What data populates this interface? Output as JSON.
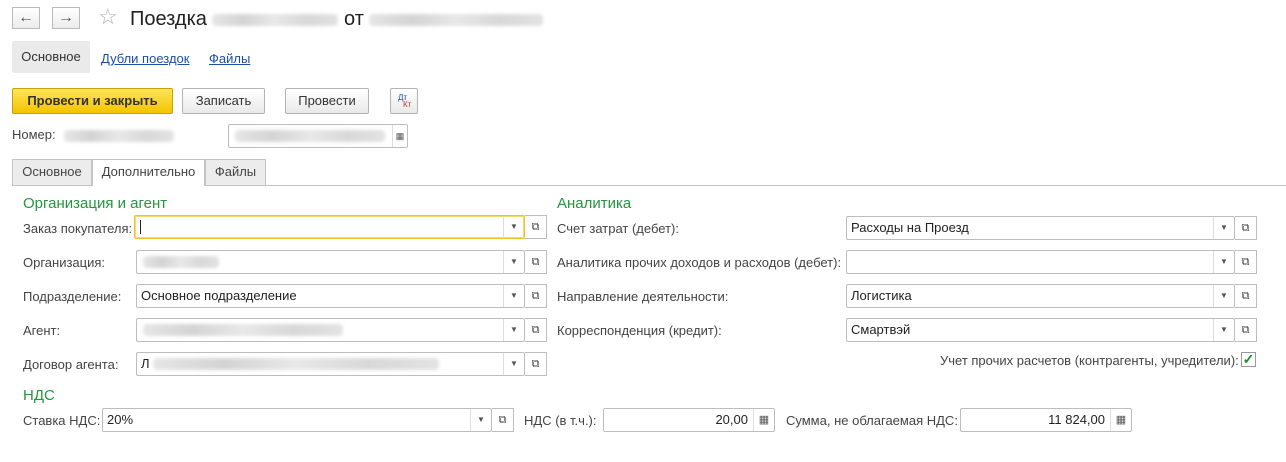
{
  "header": {
    "back_icon": "←",
    "forward_icon": "→",
    "star_icon": "☆",
    "title_prefix": "Поездка",
    "title_middle": "от"
  },
  "sections": {
    "main": "Основное",
    "duplicates": "Дубли поездок",
    "files": "Файлы"
  },
  "toolbar": {
    "post_close": "Провести и закрыть",
    "save": "Записать",
    "post": "Провести",
    "dtkt_top": "Дт",
    "dtkt_bottom": "Кт"
  },
  "number": {
    "label": "Номер:"
  },
  "tabs": [
    "Основное",
    "Дополнительно",
    "Файлы"
  ],
  "org_group": {
    "title": "Организация и агент",
    "order_label": "Заказ покупателя:",
    "order_value": "",
    "org_label": "Организация:",
    "dept_label": "Подразделение:",
    "dept_value": "Основное подразделение",
    "agent_label": "Агент:",
    "contract_label": "Договор агента:",
    "contract_prefix": "Л"
  },
  "analytics": {
    "title": "Аналитика",
    "cost_label": "Счет затрат (дебет):",
    "cost_value": "Расходы на Проезд",
    "other_label": "Аналитика прочих доходов и расходов (дебет):",
    "other_value": "",
    "direction_label": "Направление деятельности:",
    "direction_value": "Логистика",
    "corr_label": "Корреспонденция (кредит):",
    "corr_value": "Смартвэй",
    "accounting_label": "Учет прочих расчетов (контрагенты, учредители):",
    "accounting_checked": "✓"
  },
  "vat": {
    "title": "НДС",
    "rate_label": "Ставка НДС:",
    "rate_value": "20%",
    "vat_label": "НДС (в т.ч.):",
    "vat_value": "20,00",
    "untaxed_label": "Сумма, не облагаемая НДС:",
    "untaxed_value": "11 824,00"
  },
  "icons": {
    "dropdown": "▼",
    "open": "⧉",
    "calculator": "▦"
  }
}
